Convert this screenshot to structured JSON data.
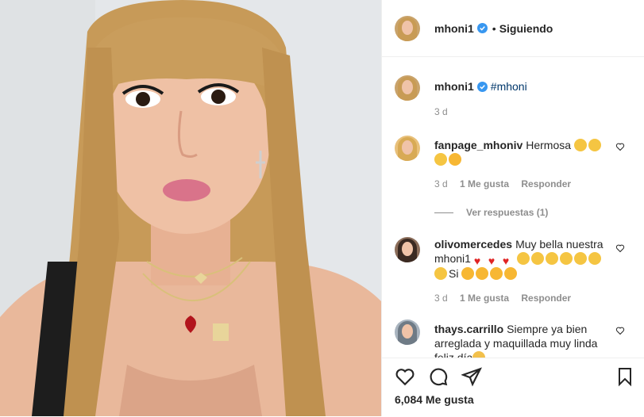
{
  "header": {
    "username": "mhoni1",
    "separator": "•",
    "follow_status": "Siguiendo"
  },
  "caption": {
    "username": "mhoni1",
    "text": "#mhoni",
    "time": "3 d"
  },
  "comments": [
    {
      "username": "fanpage_mhoniv",
      "text": "Hermosa",
      "emoji": [
        "clap",
        "clap",
        "clap",
        "star-struck"
      ],
      "time": "3 d",
      "likes": "1 Me gusta",
      "reply": "Responder"
    },
    {
      "username": "olivomercedes",
      "text": "Muy bella nuestra mhoni1",
      "emoji": [
        "heart",
        "heart",
        "heart",
        "clap",
        "clap",
        "clap",
        "clap",
        "clap",
        "clap",
        "clap"
      ],
      "suffix": "Si",
      "emoji2": [
        "star-struck",
        "star-struck",
        "star-struck",
        "star-struck"
      ],
      "time": "3 d",
      "likes": "1 Me gusta",
      "reply": "Responder"
    },
    {
      "username": "thays.carrillo",
      "text": "Siempre ya bien arreglada y maquillada muy linda feliz día",
      "emoji": [
        "raised-hands"
      ]
    }
  ],
  "view_replies": "Ver respuestas (1)",
  "likes": "6,084 Me gusta",
  "icons": {
    "like": "heart-outline-icon",
    "comment": "comment-icon",
    "share": "paper-plane-icon",
    "save": "bookmark-icon",
    "verified": "verified-badge-icon"
  },
  "colors": {
    "verified": "#3897f0",
    "text": "#262626",
    "muted": "#8e8e8e",
    "hashtag": "#00376b"
  }
}
